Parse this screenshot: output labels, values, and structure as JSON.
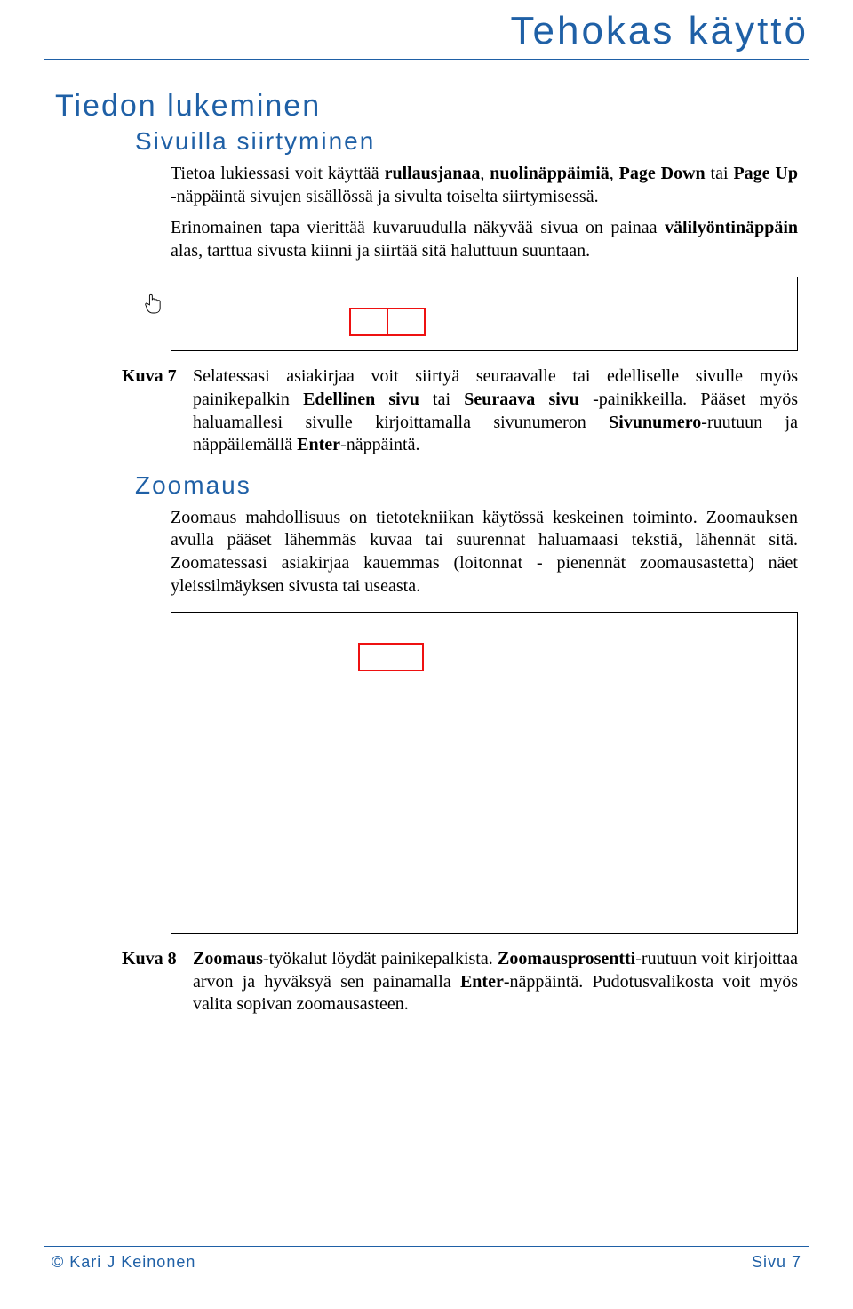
{
  "header": {
    "running_title": "Tehokas käyttö"
  },
  "section": {
    "h1": "Tiedon lukeminen",
    "h2a": "Sivuilla siirtyminen",
    "p1a": "Tietoa lukiessasi voit käyttää ",
    "p1b": "rullausjanaa",
    "p1c": ", ",
    "p1d": "nuolinäppäimiä",
    "p1e": ", ",
    "p1f": "Page Down",
    "p1g": " tai ",
    "p1h": "Page Up",
    "p1i": " -näppäintä sivujen sisällössä ja sivulta toiselta siirtymisessä.",
    "p2a": "Erinomainen tapa vierittää kuvaruudulla näkyvää sivua on painaa ",
    "p2b": "välilyöntinäppäin",
    "p2c": " alas, tarttua sivusta kiinni ja siirtää sitä haluttuun suuntaan.",
    "cap7_label": "Kuva 7",
    "cap7a": "Selatessasi asiakirjaa voit siirtyä seuraavalle tai edelliselle sivulle myös painikepalkin ",
    "cap7b": "Edellinen sivu",
    "cap7c": " tai ",
    "cap7d": "Seuraava sivu",
    "cap7e": " -painikkeilla. Pääset myös haluamallesi sivulle kirjoittamalla sivunumeron ",
    "cap7f": "Sivunumero",
    "cap7g": "-ruutuun ja näppäilemällä ",
    "cap7h": "Enter",
    "cap7i": "-näppäintä.",
    "h2b": "Zoomaus",
    "p3": "Zoomaus mahdollisuus on tietotekniikan käytössä keskeinen toiminto. Zoomauksen avulla pääset lähemmäs kuvaa tai suurennat haluamaasi tekstiä, lähennät sitä. Zoomatessasi asiakirjaa kauemmas (loitonnat - pienennät zoomausastetta) näet yleissilmäyksen sivusta tai useasta.",
    "cap8_label": "Kuva 8",
    "cap8a": "Zoomaus",
    "cap8b": "-työkalut löydät painikepalkista. ",
    "cap8c": "Zoomausprosentti",
    "cap8d": "-ruutuun voit kirjoittaa arvon ja hyväksyä sen painamalla ",
    "cap8e": "Enter",
    "cap8f": "-näppäintä. Pudotusvalikosta voit myös valita sopivan zoomausasteen."
  },
  "footer": {
    "copyright": "© Kari J Keinonen",
    "page_label": "Sivu 7"
  }
}
